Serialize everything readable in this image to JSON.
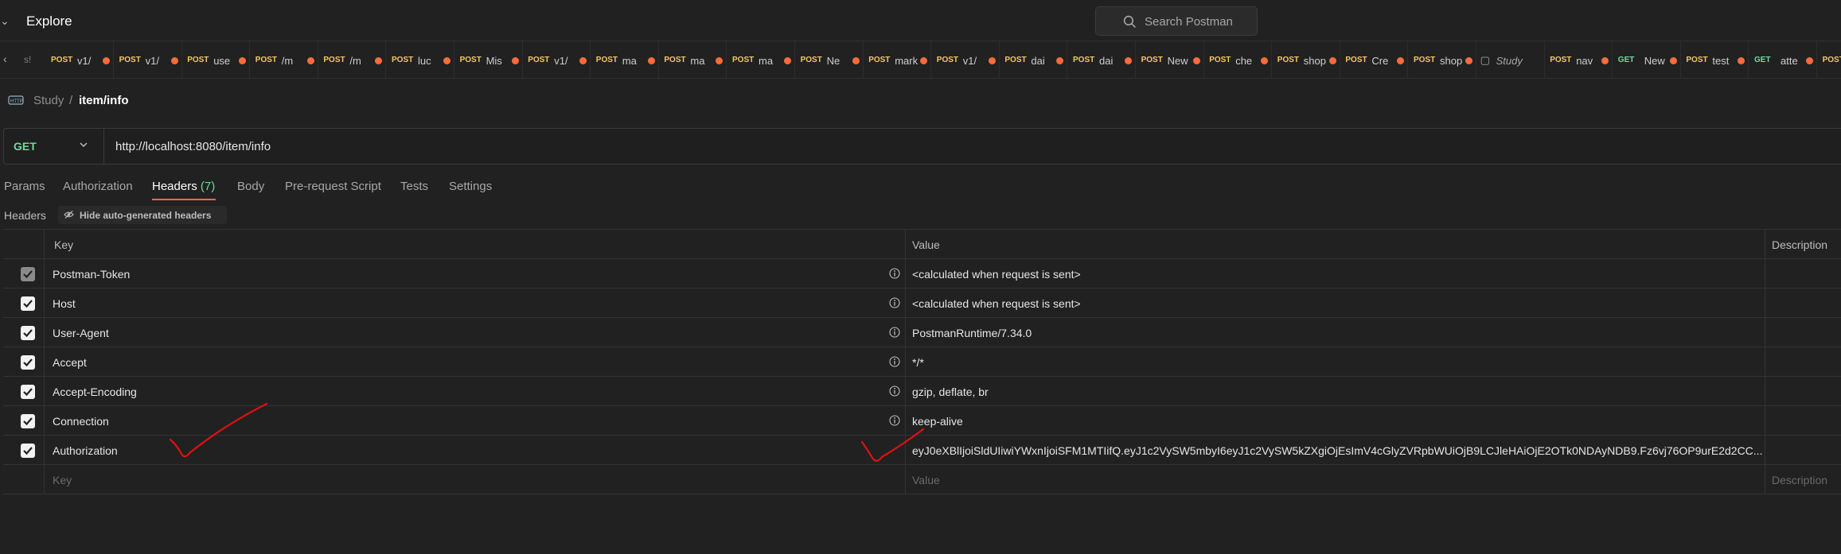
{
  "app": {
    "title": "Explore",
    "search_placeholder": "Search Postman"
  },
  "tabs": {
    "left_label": "s!",
    "items": [
      {
        "method": "POST",
        "name": "v1/"
      },
      {
        "method": "POST",
        "name": "v1/"
      },
      {
        "method": "POST",
        "name": "use"
      },
      {
        "method": "POST",
        "name": "/m"
      },
      {
        "method": "POST",
        "name": "/m"
      },
      {
        "method": "POST",
        "name": "luc"
      },
      {
        "method": "POST",
        "name": "Mis"
      },
      {
        "method": "POST",
        "name": "v1/"
      },
      {
        "method": "POST",
        "name": "ma"
      },
      {
        "method": "POST",
        "name": "ma"
      },
      {
        "method": "POST",
        "name": "ma"
      },
      {
        "method": "POST",
        "name": "Ne"
      },
      {
        "method": "POST",
        "name": "mark"
      },
      {
        "method": "POST",
        "name": "v1/"
      },
      {
        "method": "POST",
        "name": "dai"
      },
      {
        "method": "POST",
        "name": "dai"
      },
      {
        "method": "POST",
        "name": "New"
      },
      {
        "method": "POST",
        "name": "che"
      },
      {
        "method": "POST",
        "name": "shop"
      },
      {
        "method": "POST",
        "name": "Cre"
      },
      {
        "method": "POST",
        "name": "shop"
      },
      {
        "method": "",
        "name": "Study"
      },
      {
        "method": "POST",
        "name": "nav"
      },
      {
        "method": "GET",
        "name": "New"
      },
      {
        "method": "POST",
        "name": "test"
      },
      {
        "method": "GET",
        "name": "atte"
      },
      {
        "method": "POST",
        "name": ""
      }
    ]
  },
  "breadcrumb": {
    "collection": "Study",
    "separator": "/",
    "request": "item/info"
  },
  "request": {
    "method": "GET",
    "url": "http://localhost:8080/item/info"
  },
  "request_tabs": {
    "params": "Params",
    "authorization": "Authorization",
    "headers": "Headers",
    "headers_count": "(7)",
    "body": "Body",
    "prerequest": "Pre-request Script",
    "tests": "Tests",
    "settings": "Settings"
  },
  "headers_section": {
    "label": "Headers",
    "hide_button": "Hide auto-generated headers"
  },
  "table": {
    "col_key": "Key",
    "col_value": "Value",
    "col_description": "Description",
    "rows": [
      {
        "key": "Postman-Token",
        "value": "<calculated when request is sent>"
      },
      {
        "key": "Host",
        "value": "<calculated when request is sent>"
      },
      {
        "key": "User-Agent",
        "value": "PostmanRuntime/7.34.0"
      },
      {
        "key": "Accept",
        "value": "*/*"
      },
      {
        "key": "Accept-Encoding",
        "value": "gzip, deflate, br"
      },
      {
        "key": "Connection",
        "value": "keep-alive"
      },
      {
        "key": "Authorization",
        "value": "eyJ0eXBlIjoiSldUIiwiYWxnIjoiSFM1MTIifQ.eyJ1c2VySW5mbyI6eyJ1c2VySW5kZXgiOjEsImV4cGlyZVRpbWUiOjB9LCJleHAiOjE2OTk0NDAyNDB9.Fz6vj76OP9urE2d2CC..."
      }
    ],
    "new_key_placeholder": "Key",
    "new_value_placeholder": "Value",
    "new_desc_placeholder": "Description"
  },
  "colors": {
    "post": "#f5c85c",
    "get": "#6bdd9a",
    "unsaved_dot": "#ff6c37",
    "accent": "#ff6c37",
    "annotation": "#e01010"
  }
}
